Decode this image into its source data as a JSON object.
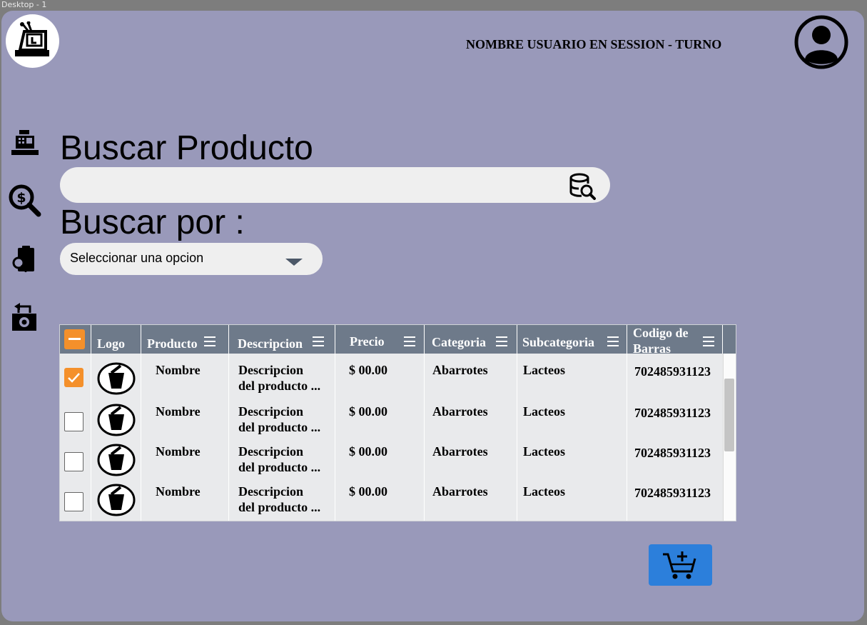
{
  "frame": {
    "label": "Desktop - 1"
  },
  "header": {
    "user_session": "NOMBRE USUARIO EN SESSION - TURNO"
  },
  "icons": {
    "logo": "cash-register-icon",
    "avatar": "user-avatar-icon",
    "sidebar": [
      "cash-register-icon",
      "price-search-icon",
      "clipboard-search-icon",
      "cash-return-icon"
    ],
    "search": "database-search-icon",
    "cart": "add-to-cart-icon"
  },
  "search": {
    "title": "Buscar Producto",
    "value": ""
  },
  "filter": {
    "title": "Buscar por :",
    "selected": "Seleccionar una opcion"
  },
  "table": {
    "headers": {
      "logo": "Logo",
      "producto": "Producto",
      "descripcion": "Descripcion",
      "precio": "Precio",
      "categoria": "Categoria",
      "subcategoria": "Subcategoria",
      "codigo_line1": "Codigo de",
      "codigo_line2": "Barras"
    },
    "rows": [
      {
        "checked": true,
        "producto": "Nombre",
        "desc1": "Descripcion",
        "desc2": "del producto ...",
        "precio": "$ 00.00",
        "categoria": "Abarrotes",
        "subcategoria": "Lacteos",
        "codigo": "702485931123"
      },
      {
        "checked": false,
        "producto": "Nombre",
        "desc1": "Descripcion",
        "desc2": "del producto ...",
        "precio": "$ 00.00",
        "categoria": "Abarrotes",
        "subcategoria": "Lacteos",
        "codigo": "702485931123"
      },
      {
        "checked": false,
        "producto": "Nombre",
        "desc1": "Descripcion",
        "desc2": "del producto ...",
        "precio": "$ 00.00",
        "categoria": "Abarrotes",
        "subcategoria": "Lacteos",
        "codigo": "702485931123"
      },
      {
        "checked": false,
        "producto": "Nombre",
        "desc1": "Descripcion",
        "desc2": "del producto ...",
        "precio": "$ 00.00",
        "categoria": "Abarrotes",
        "subcategoria": "Lacteos",
        "codigo": "702485931123"
      }
    ]
  },
  "colors": {
    "background": "#9999ba",
    "accent_orange": "#f4902b",
    "header_gray": "#6e7a8a",
    "cart_blue": "#2c7fdb"
  }
}
